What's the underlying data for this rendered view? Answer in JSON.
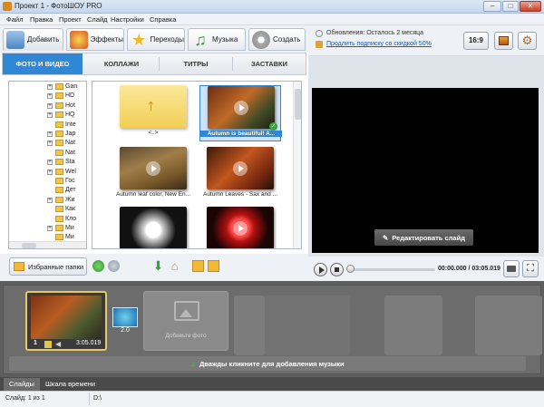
{
  "window": {
    "title": "Проект 1 - ФотоШОУ PRO",
    "minimize_glyph": "–",
    "maximize_glyph": "□",
    "close_glyph": "✕"
  },
  "menu": [
    "Файл",
    "Правка",
    "Проект",
    "Слайд",
    "Настройки",
    "Справка"
  ],
  "tabs": [
    {
      "label": "Добавить",
      "icon": "photo-add-icon"
    },
    {
      "label": "Эффекты",
      "icon": "effects-icon"
    },
    {
      "label": "Переходы",
      "icon": "star-icon"
    },
    {
      "label": "Музыка",
      "icon": "music-icon"
    },
    {
      "label": "Создать",
      "icon": "film-reel-icon"
    }
  ],
  "subtabs": [
    "ФОТО И ВИДЕО",
    "КОЛЛАЖИ",
    "ТИТРЫ",
    "ЗАСТАВКИ"
  ],
  "tree": [
    {
      "label": "Gan",
      "expander": "+"
    },
    {
      "label": "HD",
      "expander": "+"
    },
    {
      "label": "Hot",
      "expander": "+"
    },
    {
      "label": "HQ",
      "expander": "+"
    },
    {
      "label": "Inte",
      "expander": ""
    },
    {
      "label": "Jap",
      "expander": "+"
    },
    {
      "label": "Nat",
      "expander": "+"
    },
    {
      "label": "Nat",
      "expander": ""
    },
    {
      "label": "Sta",
      "expander": "+"
    },
    {
      "label": "Wel",
      "expander": "+"
    },
    {
      "label": "Гос",
      "expander": ""
    },
    {
      "label": "Дет",
      "expander": ""
    },
    {
      "label": "Жи",
      "expander": "+"
    },
    {
      "label": "Как",
      "expander": ""
    },
    {
      "label": "Кло",
      "expander": ""
    },
    {
      "label": "Ми",
      "expander": "+"
    },
    {
      "label": "Ми",
      "expander": ""
    }
  ],
  "grid": {
    "items": [
      {
        "caption": "<..>",
        "kind": "up-folder",
        "selected": false
      },
      {
        "caption": "Autumn is beautiful! A...",
        "kind": "video",
        "selected": true
      },
      {
        "caption": "Autumn leaf color, New En...",
        "kind": "video",
        "selected": false
      },
      {
        "caption": "Autumn Leaves - Sax and ...",
        "kind": "video",
        "selected": false
      },
      {
        "caption": "",
        "kind": "video",
        "selected": false
      },
      {
        "caption": "",
        "kind": "video",
        "selected": false
      }
    ]
  },
  "left_toolbar": {
    "favorites_label": "Избранные папки"
  },
  "info": {
    "updates_text": "Обновления: Осталось 2 месяца",
    "subscription_link": "Продлить подписку со скидкой 50%",
    "aspect_label": "16:9"
  },
  "preview": {
    "edit_slide_label": "Редактировать слайд",
    "time_current": "00:00.000",
    "time_separator": "/",
    "time_total": "03:05.019"
  },
  "timeline": {
    "slide_number": "1",
    "slide_duration": "3:05.019",
    "transition_duration": "2.0",
    "add_photo_label": "Добавьте фото",
    "music_hint": "Дважды кликните для добавления музыки"
  },
  "bottom_tabs": [
    "Слайды",
    "Шкала времени"
  ],
  "status": {
    "slide_info": "Слайд: 1 из 1",
    "path": "D:\\"
  },
  "colors": {
    "accent": "#2f87d5",
    "selection_frame": "#e7c867",
    "timeline_bg": "#5e5e5e"
  }
}
